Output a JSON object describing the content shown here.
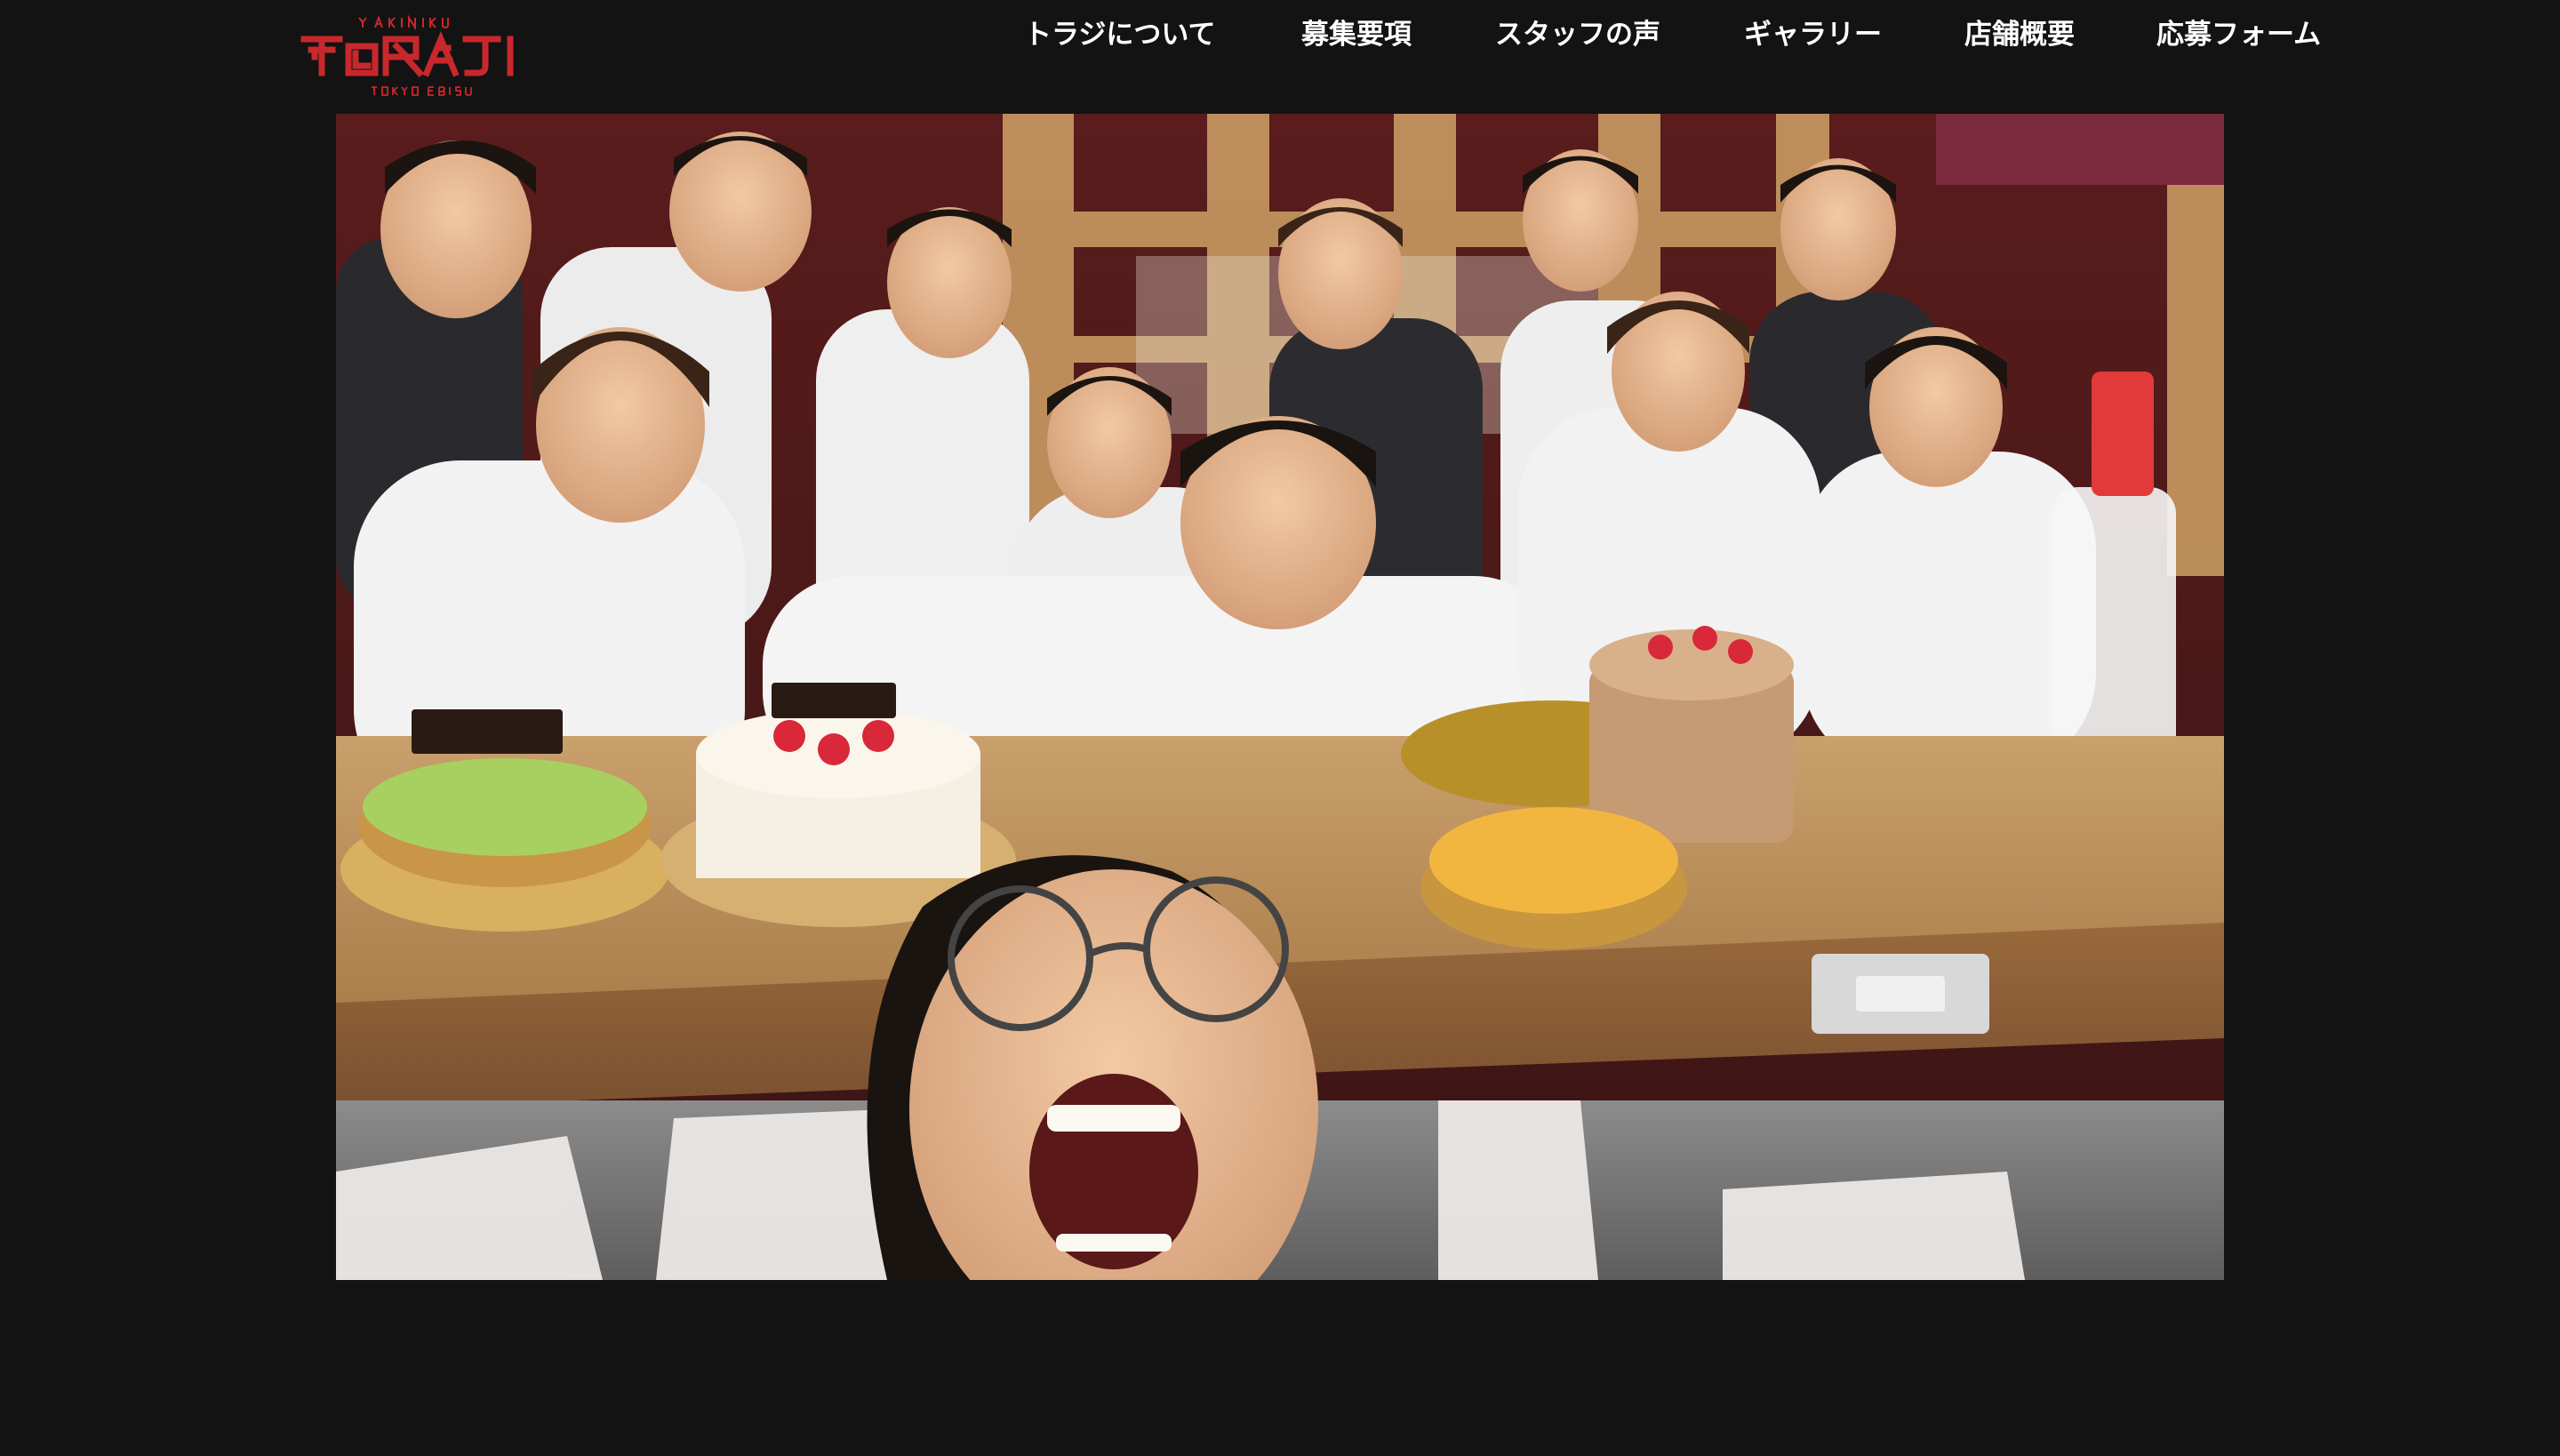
{
  "brand": {
    "top_text": "YAKINIKU",
    "name": "TORAJI",
    "bottom_text": "TOKYO EBISU",
    "color": "#c8282c"
  },
  "nav": {
    "items": [
      {
        "label": "トラジについて"
      },
      {
        "label": "募集要項"
      },
      {
        "label": "スタッフの声"
      },
      {
        "label": "ギャラリー"
      },
      {
        "label": "店舗概要"
      },
      {
        "label": "応募フォーム"
      }
    ]
  },
  "hero": {
    "image_name": "staff-group-photo"
  },
  "colors": {
    "background": "#131313",
    "text": "#ffffff"
  }
}
